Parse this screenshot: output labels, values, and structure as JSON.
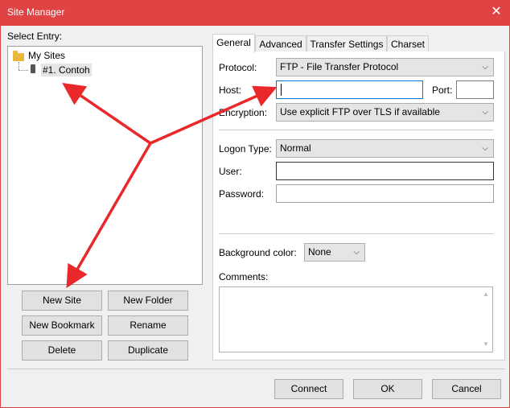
{
  "window": {
    "title": "Site Manager",
    "close_glyph": "✕"
  },
  "left": {
    "select_entry_label": "Select Entry:",
    "tree": {
      "root": "My Sites",
      "child": "#1. Contoh"
    },
    "buttons": {
      "new_site": "New Site",
      "new_folder": "New Folder",
      "new_bookmark": "New Bookmark",
      "rename": "Rename",
      "delete": "Delete",
      "duplicate": "Duplicate"
    }
  },
  "tabs": [
    "General",
    "Advanced",
    "Transfer Settings",
    "Charset"
  ],
  "general": {
    "protocol_label": "Protocol:",
    "protocol_value": "FTP - File Transfer Protocol",
    "host_label": "Host:",
    "host_value": "",
    "port_label": "Port:",
    "port_value": "",
    "encryption_label": "Encryption:",
    "encryption_value": "Use explicit FTP over TLS if available",
    "logon_type_label": "Logon Type:",
    "logon_type_value": "Normal",
    "user_label": "User:",
    "user_value": "",
    "password_label": "Password:",
    "password_value": "",
    "bg_color_label": "Background color:",
    "bg_color_value": "None",
    "comments_label": "Comments:"
  },
  "footer": {
    "connect": "Connect",
    "ok": "OK",
    "cancel": "Cancel"
  },
  "colors": {
    "titlebar": "#e04343",
    "annotation_arrow": "#e8282b"
  }
}
